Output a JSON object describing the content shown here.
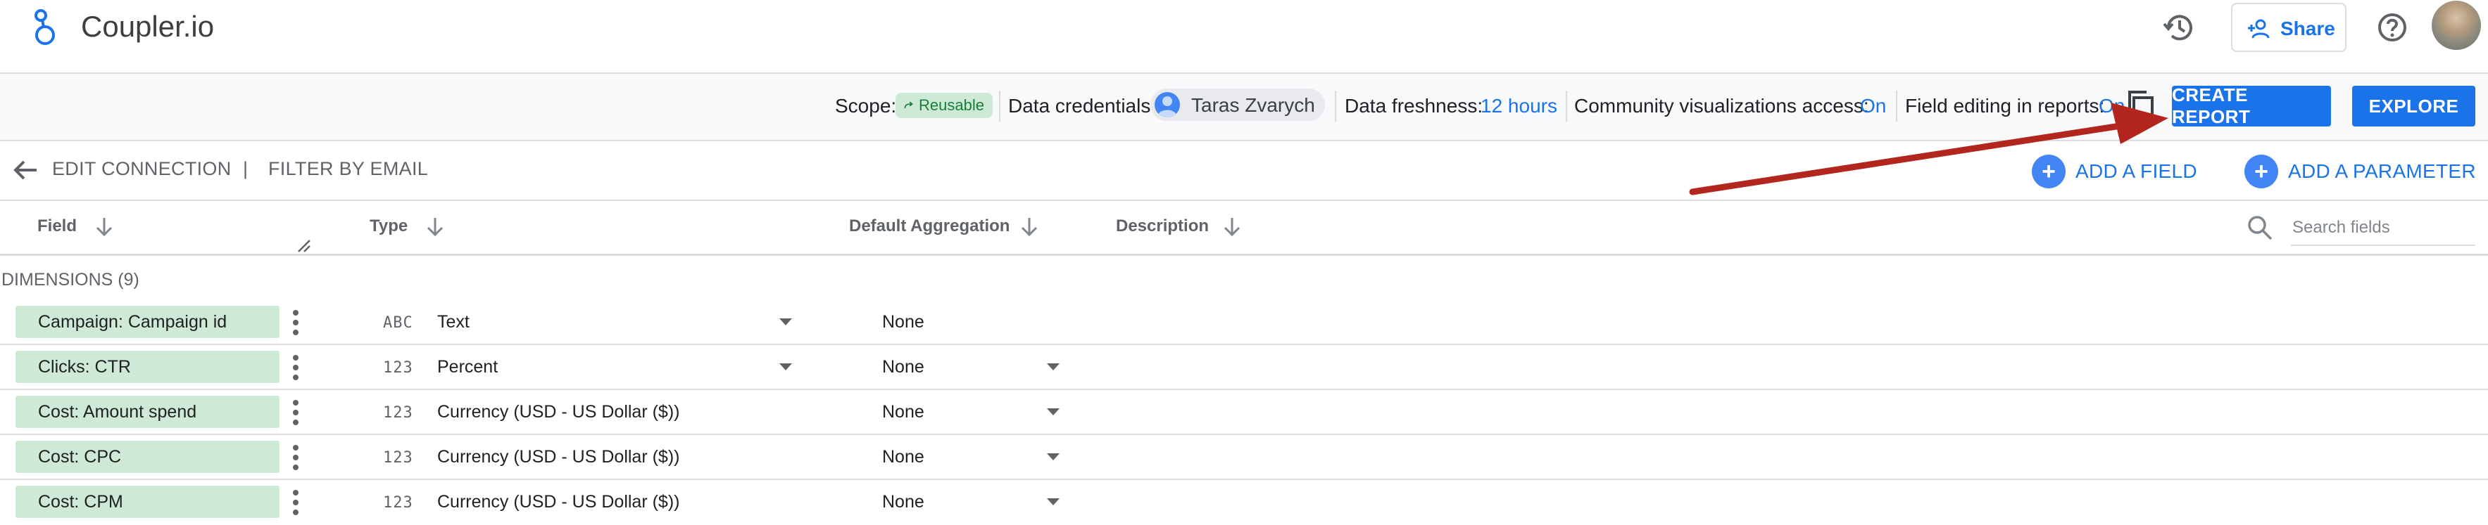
{
  "header": {
    "app_title": "Coupler.io",
    "share_label": "Share"
  },
  "toolbar": {
    "scope_label": "Scope:",
    "scope_chip": "Reusable",
    "credentials_label": "Data credentials:",
    "credentials_user": "Taras Zvarych",
    "freshness_label": "Data freshness:",
    "freshness_value": "12 hours",
    "community_label": "Community visualizations access:",
    "community_value": "On",
    "field_editing_label": "Field editing in reports:",
    "field_editing_value": "On",
    "create_report_label": "CREATE REPORT",
    "explore_label": "EXPLORE"
  },
  "subnav": {
    "edit_connection": "EDIT CONNECTION",
    "separator": "|",
    "filter_by_email": "FILTER BY EMAIL",
    "add_field": "ADD A FIELD",
    "add_parameter": "ADD A PARAMETER",
    "plus": "+"
  },
  "columns": {
    "field": "Field",
    "type": "Type",
    "default_aggregation": "Default Aggregation",
    "description": "Description",
    "search_placeholder": "Search fields"
  },
  "dimensions_header": "DIMENSIONS (9)",
  "rows": [
    {
      "name": "Campaign: Campaign id",
      "type_icon": "ABC",
      "type": "Text",
      "aggregation": "None"
    },
    {
      "name": "Clicks: CTR",
      "type_icon": "123",
      "type": "Percent",
      "aggregation": "None"
    },
    {
      "name": "Cost: Amount spend",
      "type_icon": "123",
      "type": "Currency (USD - US Dollar ($))",
      "aggregation": "None"
    },
    {
      "name": "Cost: CPC",
      "type_icon": "123",
      "type": "Currency (USD - US Dollar ($))",
      "aggregation": "None"
    },
    {
      "name": "Cost: CPM",
      "type_icon": "123",
      "type": "Currency (USD - US Dollar ($))",
      "aggregation": "None"
    }
  ],
  "colors": {
    "accent": "#1a73e8",
    "chip_green": "#ceead6",
    "annotation_arrow": "#b3261e"
  }
}
